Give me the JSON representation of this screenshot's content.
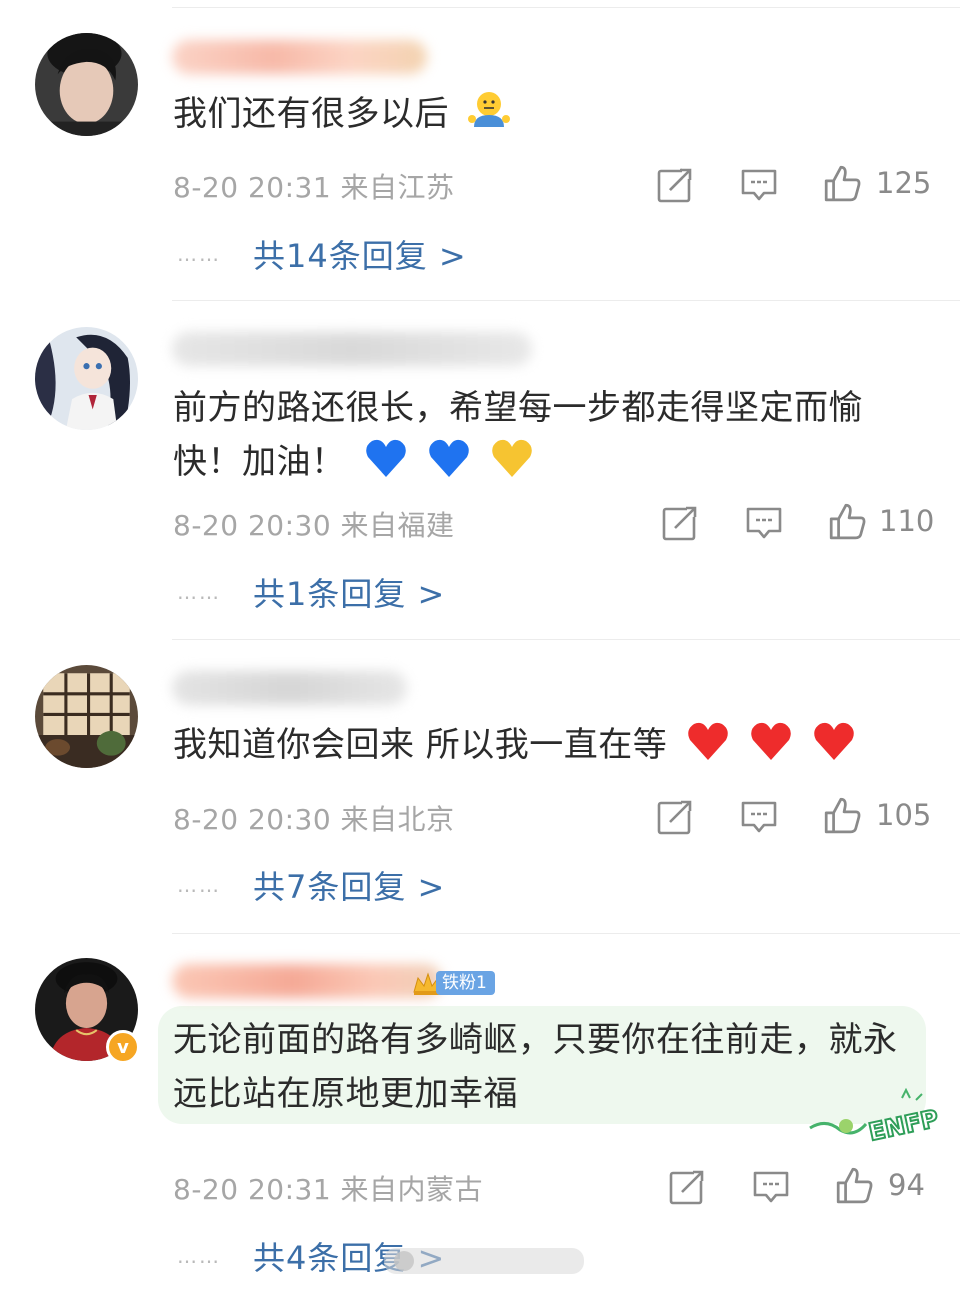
{
  "comments": [
    {
      "text": "我们还有很多以后",
      "time": "8-20 20:31",
      "location": "来自江苏",
      "likes": "125",
      "replies": "共14条回复 >",
      "dots": "……"
    },
    {
      "text": "前方的路还很长，希望每一步都走得坚定而愉快！加油！",
      "time": "8-20 20:30",
      "location": "来自福建",
      "likes": "110",
      "replies": "共1条回复 >",
      "dots": "……"
    },
    {
      "text": "我知道你会回来  所以我一直在等",
      "time": "8-20 20:30",
      "location": "来自北京",
      "likes": "105",
      "replies": "共7条回复 >",
      "dots": "……"
    },
    {
      "text": "无论前面的路有多崎岖，只要你在往前走，就永远比站在原地更加幸福",
      "time": "8-20 20:31",
      "location": "来自内蒙古",
      "likes": "94",
      "replies": "共4条回复 >",
      "dots": "……",
      "fan_badge": "铁粉1",
      "verified_badge": "v"
    }
  ],
  "sticker_text": "ENFP",
  "icons": [
    "share-icon",
    "comment-icon",
    "like-icon"
  ],
  "colors": {
    "link": "#3c6fa8",
    "meta": "#a6a6a6",
    "badge_orange": "#f6a623",
    "fan_badge": "#6aa4e4"
  }
}
